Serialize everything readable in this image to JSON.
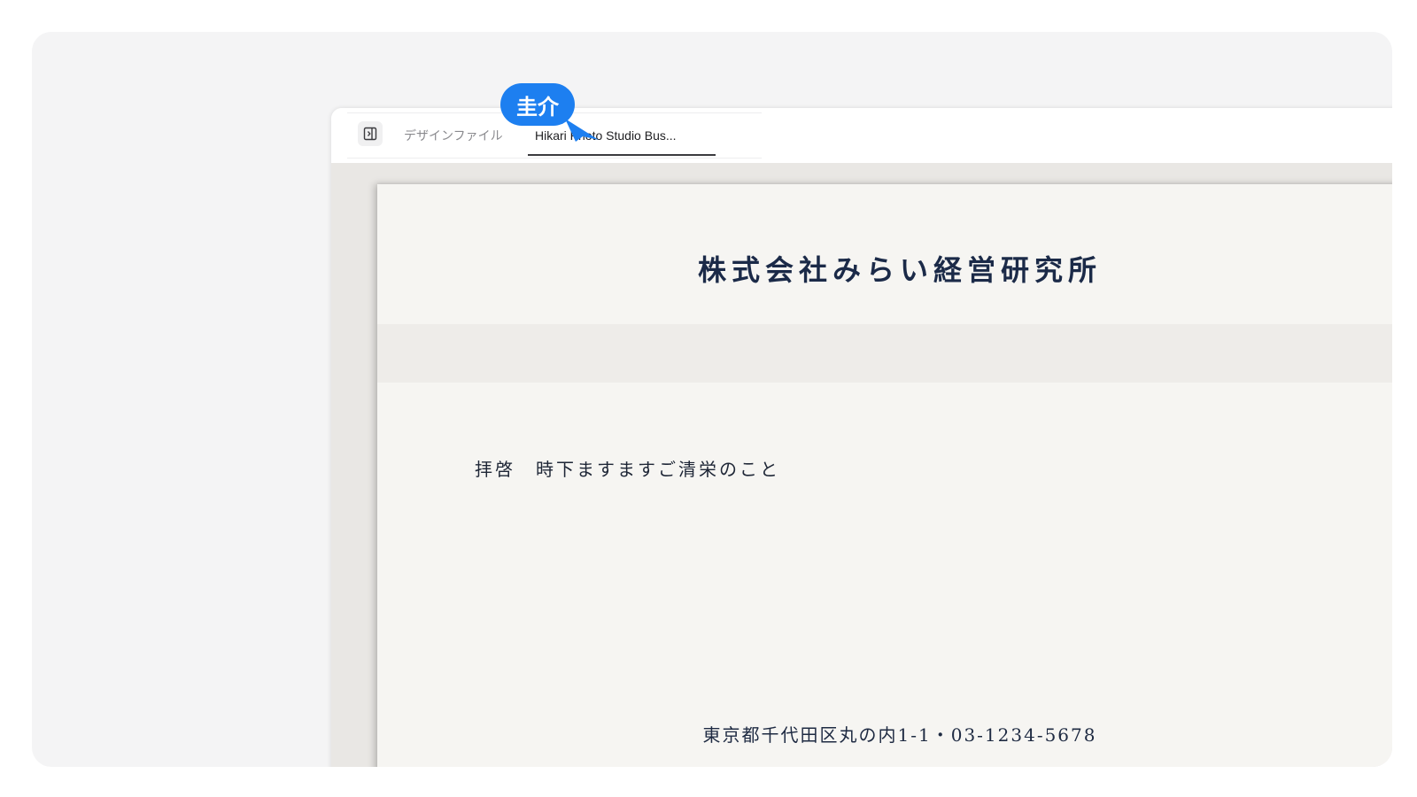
{
  "tabs": {
    "design_label": "デザインファイル",
    "active_label": "Hikari Photo Studio Bus..."
  },
  "document": {
    "company_name": "株式会社みらい経営研究所",
    "greeting": "拝啓　時下ますますご清栄のこと",
    "address_line": "東京都千代田区丸の内1-1・03-1234-5678"
  },
  "collaborator": {
    "name": "圭介",
    "color": "#1d7ff0"
  },
  "icons": {
    "sidebar_toggle": "sidebar-panel-icon",
    "cursor": "cursor-pointer-icon"
  }
}
